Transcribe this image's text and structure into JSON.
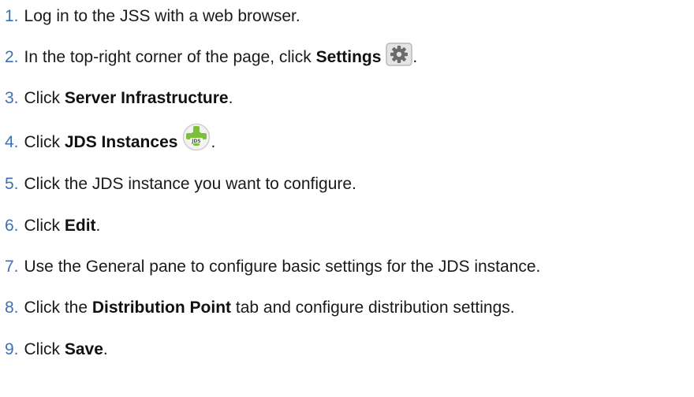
{
  "steps": [
    {
      "number": "1.",
      "parts": [
        {
          "t": "Log in to the JSS with a web browser.",
          "b": false
        }
      ]
    },
    {
      "number": "2.",
      "parts": [
        {
          "t": "In the top-right corner of the page, click ",
          "b": false
        },
        {
          "t": "Settings",
          "b": true
        }
      ],
      "icon": "gear-icon",
      "after": "."
    },
    {
      "number": "3.",
      "parts": [
        {
          "t": "Click ",
          "b": false
        },
        {
          "t": "Server Infrastructure",
          "b": true
        },
        {
          "t": ".",
          "b": false
        }
      ]
    },
    {
      "number": "4.",
      "parts": [
        {
          "t": "Click ",
          "b": false
        },
        {
          "t": "JDS Instances",
          "b": true
        }
      ],
      "icon": "jds-icon",
      "after": "."
    },
    {
      "number": "5.",
      "parts": [
        {
          "t": "Click the JDS instance you want to configure.",
          "b": false
        }
      ]
    },
    {
      "number": "6.",
      "parts": [
        {
          "t": "Click ",
          "b": false
        },
        {
          "t": "Edit",
          "b": true
        },
        {
          "t": ".",
          "b": false
        }
      ]
    },
    {
      "number": "7.",
      "parts": [
        {
          "t": "Use the General pane to configure basic settings for the JDS instance.",
          "b": false
        }
      ]
    },
    {
      "number": "8.",
      "parts": [
        {
          "t": "Click the ",
          "b": false
        },
        {
          "t": "Distribution Point",
          "b": true
        },
        {
          "t": " tab and configure distribution settings.",
          "b": false
        }
      ]
    },
    {
      "number": "9.",
      "parts": [
        {
          "t": "Click ",
          "b": false
        },
        {
          "t": "Save",
          "b": true
        },
        {
          "t": ".",
          "b": false
        }
      ]
    }
  ],
  "jds_icon_text": "JDS",
  "colors": {
    "number": "#3f6fb5",
    "text": "#1a1a1a",
    "gear_frame": "#b9b9b9",
    "jds_green": "#7bbf3a"
  }
}
